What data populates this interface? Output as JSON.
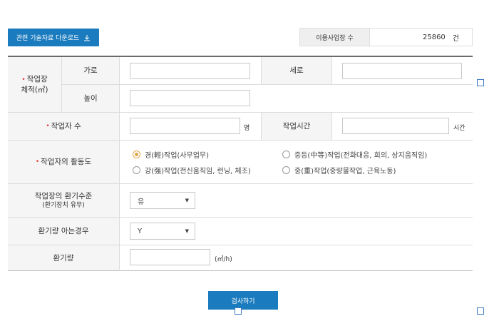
{
  "download_button": {
    "label": "관련 기술자료 다운로드",
    "icon": "download-icon"
  },
  "usage": {
    "label": "이용사업장 수",
    "value": "25860",
    "unit": "건"
  },
  "form": {
    "volume": {
      "label_line1": "작업장",
      "label_line2": "체적(㎥)",
      "width_label": "가로",
      "length_label": "세로",
      "height_label": "높이"
    },
    "workers": {
      "label": "작업자 수",
      "unit": "명",
      "hours_label": "작업시간",
      "hours_unit": "시간"
    },
    "activity": {
      "label": "작업자의 활동도",
      "options": [
        {
          "label": "경(輕)작업(사무업무)",
          "selected": true
        },
        {
          "label": "중등(中等)작업(전화대응, 회의, 상지움직임)",
          "selected": false
        },
        {
          "label": "강(强)작업(전신움직임, 런닝, 체조)",
          "selected": false
        },
        {
          "label": "중(重)작업(중량물작업, 근육노동)",
          "selected": false
        }
      ]
    },
    "ventilation_level": {
      "label_line1": "작업장의 환기수준",
      "label_line2": "(환기장치 유무)",
      "value": "유"
    },
    "ventilation_known": {
      "label": "환기량 아는경우",
      "value": "Y"
    },
    "ventilation_amount": {
      "label": "환기량",
      "unit": "(㎥/h)"
    }
  },
  "submit": {
    "label": "검사하기"
  },
  "colors": {
    "primary": "#1a7bbf",
    "required": "#e03b3b",
    "radio_selected": "#e2a54a"
  }
}
